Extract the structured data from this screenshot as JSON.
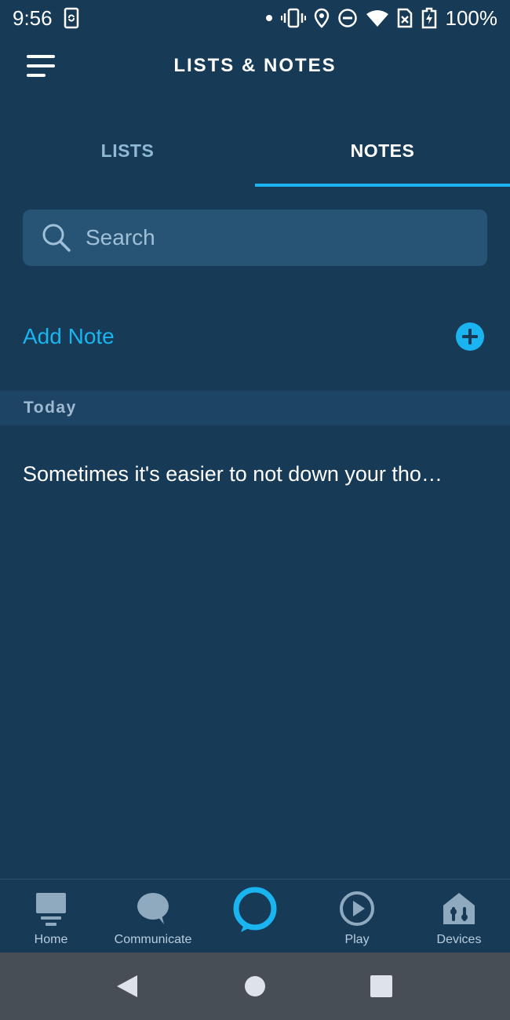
{
  "status_bar": {
    "time": "9:56",
    "battery_percent": "100%"
  },
  "app_bar": {
    "title": "LISTS & NOTES"
  },
  "tabs": [
    {
      "label": "LISTS",
      "active": false
    },
    {
      "label": "NOTES",
      "active": true
    }
  ],
  "search": {
    "placeholder": "Search",
    "value": ""
  },
  "add_note": {
    "label": "Add Note"
  },
  "section": {
    "title": "Today"
  },
  "notes": [
    {
      "text": "Sometimes it's easier to not down your tho…"
    }
  ],
  "bottom_nav": {
    "items": [
      {
        "label": "Home",
        "icon": "home-icon"
      },
      {
        "label": "Communicate",
        "icon": "chat-bubble-icon"
      },
      {
        "label": "",
        "icon": "alexa-icon"
      },
      {
        "label": "Play",
        "icon": "play-icon"
      },
      {
        "label": "Devices",
        "icon": "devices-icon"
      }
    ]
  },
  "colors": {
    "background": "#173a56",
    "accent": "#1ab4f0",
    "search_bg": "#275475",
    "section_bg": "#1d4464",
    "system_nav_bg": "#474e56"
  }
}
